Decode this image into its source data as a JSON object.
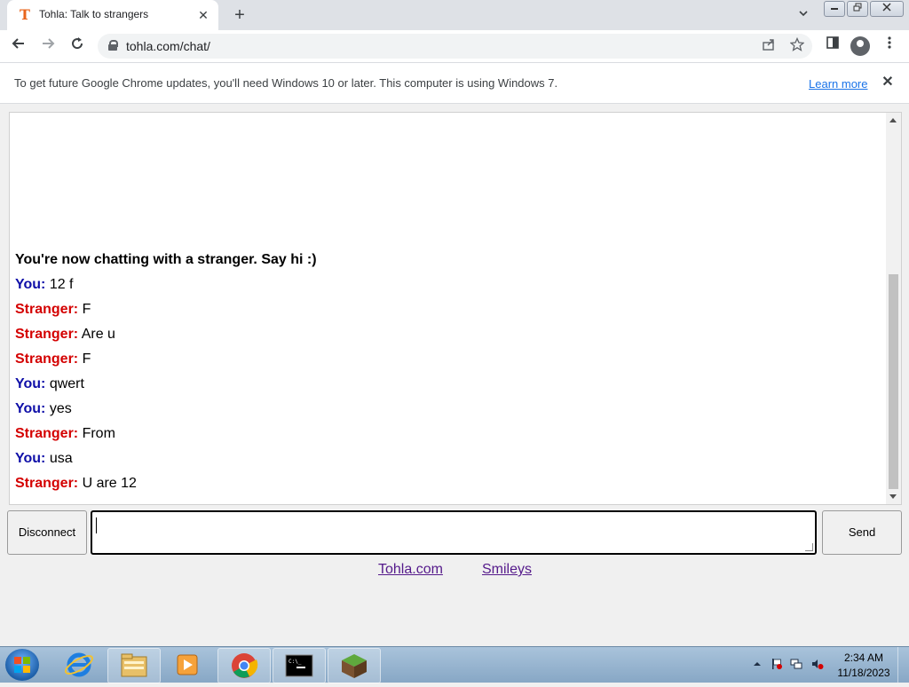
{
  "browser": {
    "tab_title": "Tohla: Talk to strangers",
    "tab_favicon": "T",
    "tab_close": "✕",
    "new_tab": "+",
    "url": "tohla.com/chat/"
  },
  "infobar": {
    "message": "To get future Google Chrome updates, you'll need Windows 10 or later. This computer is using Windows 7.",
    "link": "Learn more",
    "close": "✕"
  },
  "chat": {
    "status": "You're now chatting with a stranger. Say hi :)",
    "messages": [
      {
        "who": "You:",
        "text": "12 f",
        "role": "you"
      },
      {
        "who": "Stranger:",
        "text": "F",
        "role": "stranger"
      },
      {
        "who": "Stranger:",
        "text": "Are u",
        "role": "stranger"
      },
      {
        "who": "Stranger:",
        "text": "F",
        "role": "stranger"
      },
      {
        "who": "You:",
        "text": "qwert",
        "role": "you"
      },
      {
        "who": "You:",
        "text": "yes",
        "role": "you"
      },
      {
        "who": "Stranger:",
        "text": "From",
        "role": "stranger"
      },
      {
        "who": "You:",
        "text": "usa",
        "role": "you"
      },
      {
        "who": "Stranger:",
        "text": "U are 12",
        "role": "stranger"
      }
    ],
    "disconnect_label": "Disconnect",
    "send_label": "Send",
    "input_value": ""
  },
  "footer": {
    "site_link": "Tohla.com",
    "smileys_link": "Smileys"
  },
  "taskbar": {
    "time": "2:34 AM",
    "date": "11/18/2023",
    "items": [
      "internet-explorer-icon",
      "file-explorer-icon",
      "media-player-icon",
      "chrome-icon",
      "command-prompt-icon",
      "minecraft-icon"
    ]
  },
  "colors": {
    "you": "#0f0fa8",
    "stranger": "#d40000",
    "link_visited": "#551a8b",
    "chrome_link": "#1a73e8"
  }
}
